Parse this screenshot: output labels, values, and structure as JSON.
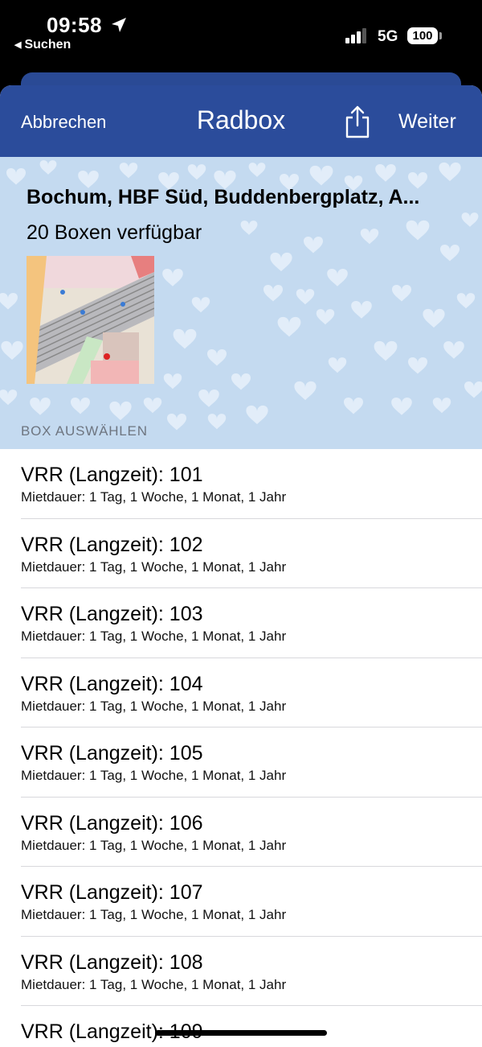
{
  "status_bar": {
    "time": "09:58",
    "back_label": "Suchen",
    "network": "5G",
    "battery": "100"
  },
  "nav": {
    "cancel_label": "Abbrechen",
    "title": "Radbox",
    "next_label": "Weiter",
    "share_icon": "share-icon"
  },
  "station": {
    "name": "Bochum, HBF Süd, Buddenbergplatz, A...",
    "availability": "20 Boxen verfügbar"
  },
  "section_label": "BOX AUSWÄHLEN",
  "boxes": [
    {
      "title": "VRR (Langzeit): 101",
      "subtitle": "Mietdauer: 1 Tag, 1 Woche, 1 Monat, 1 Jahr"
    },
    {
      "title": "VRR (Langzeit): 102",
      "subtitle": "Mietdauer: 1 Tag, 1 Woche, 1 Monat, 1 Jahr"
    },
    {
      "title": "VRR (Langzeit): 103",
      "subtitle": "Mietdauer: 1 Tag, 1 Woche, 1 Monat, 1 Jahr"
    },
    {
      "title": "VRR (Langzeit): 104",
      "subtitle": "Mietdauer: 1 Tag, 1 Woche, 1 Monat, 1 Jahr"
    },
    {
      "title": "VRR (Langzeit): 105",
      "subtitle": "Mietdauer: 1 Tag, 1 Woche, 1 Monat, 1 Jahr"
    },
    {
      "title": "VRR (Langzeit): 106",
      "subtitle": "Mietdauer: 1 Tag, 1 Woche, 1 Monat, 1 Jahr"
    },
    {
      "title": "VRR (Langzeit): 107",
      "subtitle": "Mietdauer: 1 Tag, 1 Woche, 1 Monat, 1 Jahr"
    },
    {
      "title": "VRR (Langzeit): 108",
      "subtitle": "Mietdauer: 1 Tag, 1 Woche, 1 Monat, 1 Jahr"
    },
    {
      "title": "VRR (Langzeit): 109",
      "subtitle": ""
    }
  ],
  "colors": {
    "nav_bg": "#2b4c9b",
    "header_bg": "#c4daf0",
    "separator": "#d8d8dc"
  }
}
